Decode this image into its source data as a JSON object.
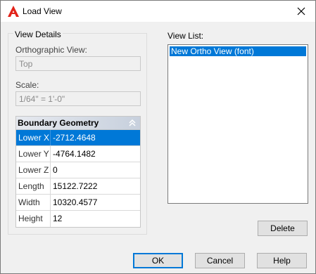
{
  "window": {
    "title": "Load View",
    "accent_color": "#0078d7"
  },
  "view_details": {
    "legend": "View Details",
    "ortho_label": "Orthographic View:",
    "ortho_value": "Top",
    "scale_label": "Scale:",
    "scale_value": "1/64\" = 1'-0\""
  },
  "boundary_geometry": {
    "header": "Boundary Geometry",
    "rows": [
      {
        "key": "Lower X",
        "value": "-2712.4648",
        "selected": true
      },
      {
        "key": "Lower Y",
        "value": "-4764.1482"
      },
      {
        "key": "Lower Z",
        "value": "0"
      },
      {
        "key": "Length",
        "value": "15122.7222"
      },
      {
        "key": "Width",
        "value": "10320.4577"
      },
      {
        "key": "Height",
        "value": "12"
      }
    ]
  },
  "view_list": {
    "label": "View List:",
    "items": [
      "New Ortho View (font)"
    ]
  },
  "buttons": {
    "delete": "Delete",
    "ok": "OK",
    "cancel": "Cancel",
    "help": "Help"
  },
  "icons": {
    "app": "autocad-logo-icon",
    "close": "close-icon",
    "collapse": "double-chevron-up-icon"
  }
}
